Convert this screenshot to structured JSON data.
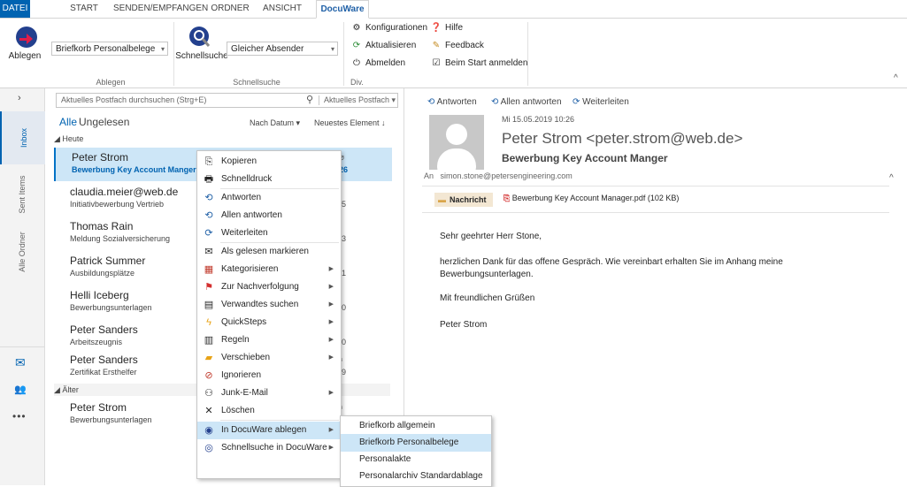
{
  "tabs": [
    "DATEI",
    "START",
    "SENDEN/EMPFANGEN",
    "ORDNER",
    "ANSICHT",
    "DocuWare"
  ],
  "ribbon": {
    "ablegen_button": "Ablegen",
    "briefkorb_select": "Briefkorb Personalbelege",
    "schnellsuche_button": "Schnellsuche",
    "absender_select": "Gleicher Absender",
    "konfigurationen": "Konfigurationen",
    "aktualisieren": "Aktualisieren",
    "abmelden": "Abmelden",
    "hilfe": "Hilfe",
    "feedback": "Feedback",
    "beim_start": "Beim Start anmelden",
    "group_ablegen": "Ablegen",
    "group_schnellsuche": "Schnellsuche",
    "group_div": "Div."
  },
  "rail": {
    "inbox": "Inbox",
    "sent": "Sent Items",
    "alle": "Alle Ordner"
  },
  "list": {
    "search_placeholder": "Aktuelles Postfach durchsuchen (Strg+E)",
    "search_scope": "Aktuelles Postfach",
    "filter_all": "Alle",
    "filter_unread": "Ungelesen",
    "sort_by": "Nach Datum",
    "sort_order": "Neuestes Element",
    "group_today": "Heute",
    "group_older": "Älter",
    "items": [
      {
        "from": "Peter Strom",
        "subject": "Bewerbung Key Account Manger",
        "time": "10:26"
      },
      {
        "from": "claudia.meier@web.de",
        "subject": "Initiativbewerbung Vertrieb",
        "time": "10:25"
      },
      {
        "from": "Thomas Rain",
        "subject": "Meldung Sozialversicherung",
        "time": "10:23"
      },
      {
        "from": "Patrick Summer",
        "subject": "Ausbildungsplätze",
        "time": "10:21"
      },
      {
        "from": "Helli Iceberg",
        "subject": "Bewerbungsunterlagen",
        "time": "10:20"
      },
      {
        "from": "Peter Sanders",
        "subject": "Arbeitszeugnis",
        "time": "10:10"
      },
      {
        "from": "Peter Sanders",
        "subject": "Zertifikat Ersthelfer",
        "time": "10:09"
      },
      {
        "from": "Peter Strom",
        "subject": "Bewerbungsunterlagen",
        "time": ""
      }
    ]
  },
  "reading": {
    "reply": "Antworten",
    "reply_all": "Allen antworten",
    "forward": "Weiterleiten",
    "date": "Mi 15.05.2019 10:26",
    "sender": "Peter Strom <peter.strom@web.de>",
    "subject": "Bewerbung Key Account Manger",
    "to_label": "An",
    "to": "simon.stone@petersengineering.com",
    "tab_message": "Nachricht",
    "attachment": "Bewerbung Key Account Manager.pdf (102 KB)",
    "body": [
      "Sehr geehrter Herr Stone,",
      "herzlichen Dank für das offene Gespräch. Wie vereinbart erhalten Sie im Anhang meine Bewerbungsunterlagen.",
      "Mit freundlichen Grüßen",
      "Peter Strom"
    ]
  },
  "context_menu": [
    "Kopieren",
    "Schnelldruck",
    "Antworten",
    "Allen antworten",
    "Weiterleiten",
    "Als gelesen markieren",
    "Kategorisieren",
    "Zur Nachverfolgung",
    "Verwandtes suchen",
    "QuickSteps",
    "Regeln",
    "Verschieben",
    "Ignorieren",
    "Junk-E-Mail",
    "Löschen",
    "In DocuWare ablegen",
    "Schnellsuche in DocuWare"
  ],
  "submenu": [
    "Briefkorb allgemein",
    "Briefkorb Personalbelege",
    "Personalakte",
    "Personalarchiv Standardablage"
  ],
  "colors": {
    "accent": "#0063b1",
    "selection": "#cde6f7"
  }
}
